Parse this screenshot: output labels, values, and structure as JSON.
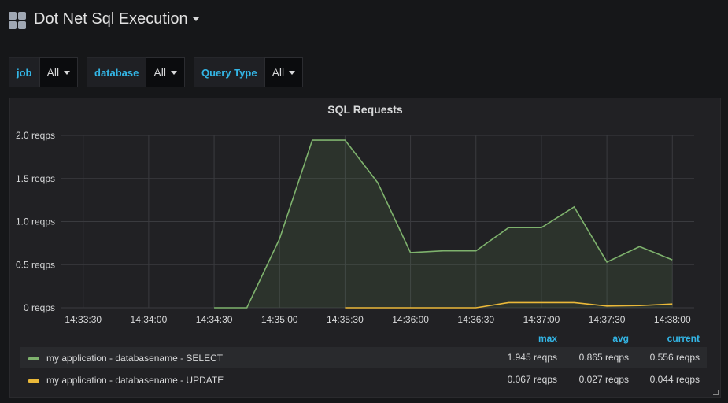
{
  "header": {
    "title": "Dot Net Sql Execution",
    "icon": "dashboard-grid-icon"
  },
  "variables": [
    {
      "label": "job",
      "value": "All"
    },
    {
      "label": "database",
      "value": "All"
    },
    {
      "label": "Query Type",
      "value": "All"
    }
  ],
  "panel": {
    "title": "SQL Requests",
    "legend": {
      "headers": {
        "max": "max",
        "avg": "avg",
        "current": "current"
      },
      "rows": [
        {
          "name": "my application - databasename - SELECT",
          "color": "#7eb26d",
          "max": "1.945 reqps",
          "avg": "0.865 reqps",
          "current": "0.556 reqps"
        },
        {
          "name": "my application - databasename - UPDATE",
          "color": "#eab839",
          "max": "0.067 reqps",
          "avg": "0.027 reqps",
          "current": "0.044 reqps"
        }
      ]
    }
  },
  "chart_data": {
    "type": "area",
    "title": "SQL Requests",
    "x_unit": "time",
    "x": [
      "14:34:35",
      "14:34:45",
      "14:35:00",
      "14:35:15",
      "14:35:30",
      "14:35:45",
      "14:36:00",
      "14:36:15",
      "14:36:30",
      "14:36:45",
      "14:37:00",
      "14:37:15",
      "14:37:30",
      "14:37:45",
      "14:38:00"
    ],
    "xticks": [
      "14:33:30",
      "14:34:00",
      "14:34:30",
      "14:35:00",
      "14:35:30",
      "14:36:00",
      "14:36:30",
      "14:37:00",
      "14:37:30",
      "14:38:00"
    ],
    "yticks": [
      "0 reqps",
      "0.5 reqps",
      "1.0 reqps",
      "1.5 reqps",
      "2.0 reqps"
    ],
    "ylim": [
      0,
      2.0
    ],
    "xlim": [
      "14:33:20",
      "14:38:10"
    ],
    "grid": true,
    "series": [
      {
        "name": "my application - databasename - SELECT",
        "color": "#7eb26d",
        "fill": true,
        "points": [
          [
            "14:34:30",
            0
          ],
          [
            "14:34:45",
            0
          ],
          [
            "14:35:00",
            0.8
          ],
          [
            "14:35:15",
            1.945
          ],
          [
            "14:35:30",
            1.945
          ],
          [
            "14:35:45",
            1.45
          ],
          [
            "14:36:00",
            0.64
          ],
          [
            "14:36:15",
            0.66
          ],
          [
            "14:36:30",
            0.66
          ],
          [
            "14:36:45",
            0.93
          ],
          [
            "14:37:00",
            0.93
          ],
          [
            "14:37:15",
            1.17
          ],
          [
            "14:37:30",
            0.53
          ],
          [
            "14:37:45",
            0.71
          ],
          [
            "14:38:00",
            0.556
          ]
        ]
      },
      {
        "name": "my application - databasename - UPDATE",
        "color": "#eab839",
        "fill": false,
        "points": [
          [
            "14:35:30",
            0
          ],
          [
            "14:35:45",
            0
          ],
          [
            "14:36:00",
            0
          ],
          [
            "14:36:15",
            0
          ],
          [
            "14:36:30",
            0
          ],
          [
            "14:36:45",
            0.06
          ],
          [
            "14:37:00",
            0.06
          ],
          [
            "14:37:15",
            0.06
          ],
          [
            "14:37:30",
            0.02
          ],
          [
            "14:37:45",
            0.025
          ],
          [
            "14:38:00",
            0.044
          ]
        ]
      }
    ]
  }
}
